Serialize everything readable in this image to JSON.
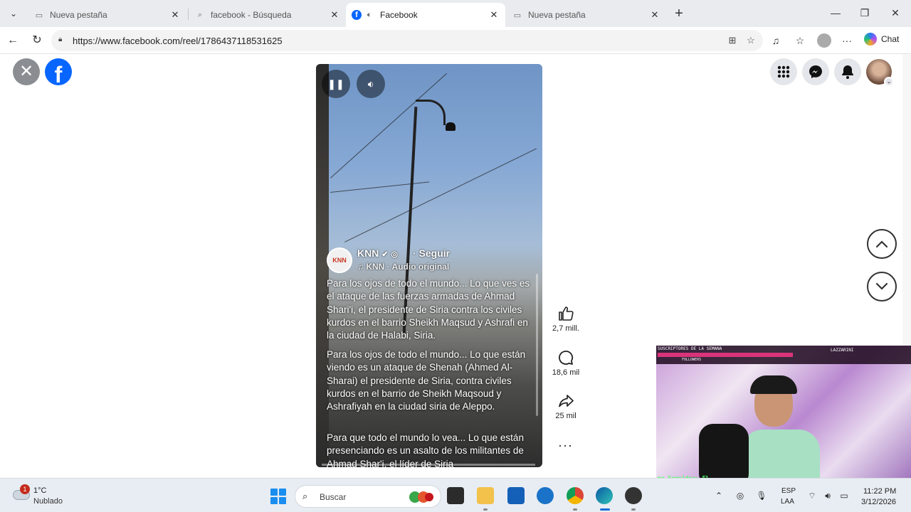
{
  "browser": {
    "tabs": [
      {
        "label": "Nueva pestaña",
        "icon": "page-icon",
        "active": false
      },
      {
        "label": "facebook - Búsqueda",
        "icon": "search-icon",
        "active": false
      },
      {
        "label": "Facebook",
        "icon": "facebook-icon",
        "active": true
      },
      {
        "label": "Nueva pestaña",
        "icon": "page-icon",
        "active": false
      }
    ],
    "url": "https://www.facebook.com/reel/1786437118531625",
    "chat_label": "Chat"
  },
  "reel": {
    "channel_name": "KNN",
    "follow_label": "· Seguir",
    "audio_label": "♫ KNN · Audio original",
    "channel_logo_text": "KNN",
    "captions": [
      "Para los ojos de todo el mundo... Lo que ves es el ataque de las fuerzas armadas de Ahmad Shari'i, el presidente de Siria contra los civiles kurdos en el barrio Sheikh Maqsud y Ashrafi en la ciudad de Halabi, Siria.",
      "Para los ojos de todo el mundo... Lo que están viendo es un ataque de Shenah (Ahmed Al-Sharai) el presidente de Siria, contra civiles kurdos en el barrio de Sheikh Maqsoud y Ashrafiyah en la ciudad siria de Aleppo.",
      "Para que todo el mundo lo vea... Lo que están presenciando es un asalto de los militantes de Ahmad Shar'i, el líder de Siria"
    ],
    "likes": "2,7 mill.",
    "comments": "18,6 mil",
    "shares": "25 mil",
    "more": "···"
  },
  "webcam": {
    "top_left": "SUSCRIPTORES DE LA SEMANA",
    "top_right": "LAZZARINI",
    "followers_label": "FOLLOWERS",
    "ticker": "mo Seguidor: El"
  },
  "taskbar": {
    "weather_badge": "1",
    "temperature": "1°C",
    "weather_desc": "Nublado",
    "search_placeholder": "Buscar",
    "lang_line1": "ESP",
    "lang_line2": "LAA",
    "time": "11:22 PM",
    "date": "3/12/2026"
  },
  "colors": {
    "facebook_blue": "#0866ff",
    "win_blue": "#1a8ef0",
    "badge_red": "#c42b1c"
  }
}
